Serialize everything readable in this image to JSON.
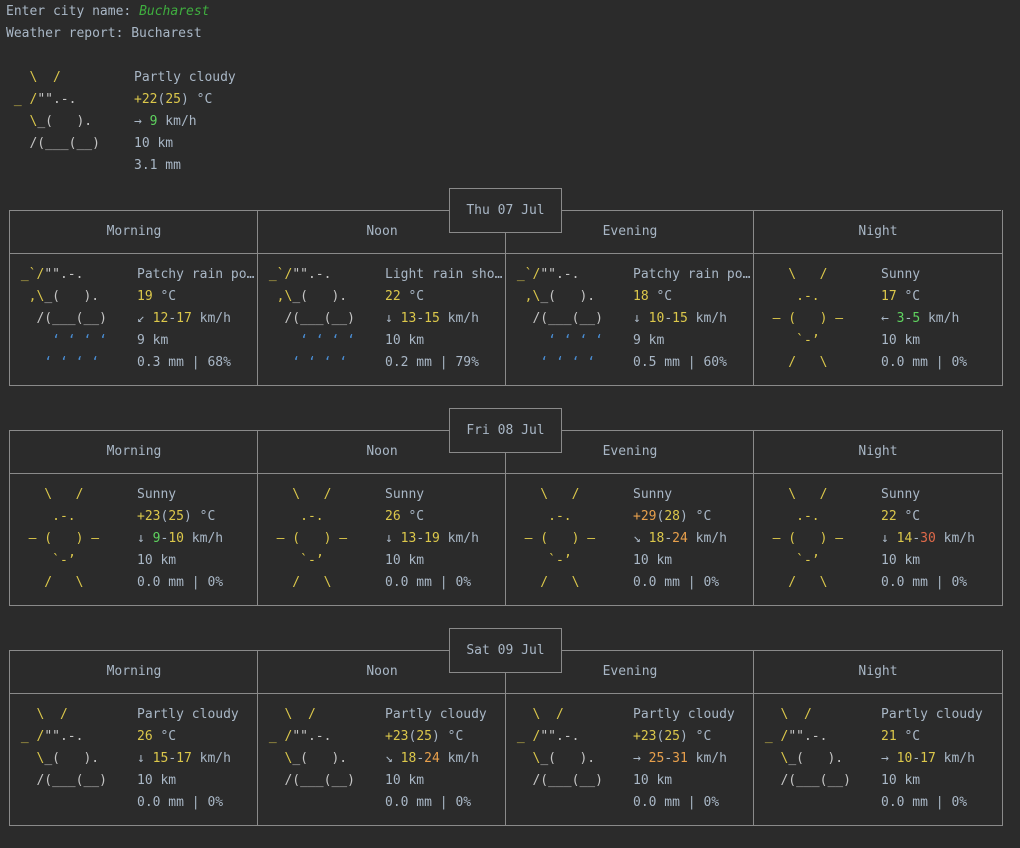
{
  "prompt": {
    "label": "Enter city name: ",
    "value": "Bucharest"
  },
  "report_title": "Weather report: Bucharest",
  "current": {
    "icon": [
      "   \\  /",
      " _ /\"\".-.",
      "   \\_(   ).",
      "   /(___(__)",
      ""
    ],
    "condition": "Partly cloudy",
    "temp_main": "+22",
    "temp_feels": "25",
    "temp_unit": " °C",
    "wind_arrow": "→",
    "wind": "9",
    "wind_unit": " km/h",
    "visibility": "10 km",
    "precip": "3.1 mm"
  },
  "days": [
    {
      "date": "Thu 07 Jul",
      "periods": [
        {
          "name": "Morning",
          "icon_type": "rain",
          "condition": "Patchy rain po…",
          "temp": "19",
          "feels": "",
          "temp_color": "yel",
          "wind_arrow": "↙",
          "wind_lo": "12",
          "wind_hi": "17",
          "wind_lo_color": "yel",
          "wind_hi_color": "yel",
          "visibility": "9 km",
          "precip": "0.3 mm | 68%"
        },
        {
          "name": "Noon",
          "icon_type": "rain",
          "condition": "Light rain sho…",
          "temp": "22",
          "feels": "",
          "temp_color": "yel",
          "wind_arrow": "↓",
          "wind_lo": "13",
          "wind_hi": "15",
          "wind_lo_color": "yel",
          "wind_hi_color": "yel",
          "visibility": "10 km",
          "precip": "0.2 mm | 79%"
        },
        {
          "name": "Evening",
          "icon_type": "rain",
          "condition": "Patchy rain po…",
          "temp": "18",
          "feels": "",
          "temp_color": "yel",
          "wind_arrow": "↓",
          "wind_lo": "10",
          "wind_hi": "15",
          "wind_lo_color": "yel",
          "wind_hi_color": "yel",
          "visibility": "9 km",
          "precip": "0.5 mm | 60%"
        },
        {
          "name": "Night",
          "icon_type": "sun",
          "condition": "Sunny",
          "temp": "17",
          "feels": "",
          "temp_color": "yel",
          "wind_arrow": "←",
          "wind_lo": "3",
          "wind_hi": "5",
          "wind_lo_color": "grn",
          "wind_hi_color": "grn",
          "visibility": "10 km",
          "precip": "0.0 mm | 0%"
        }
      ]
    },
    {
      "date": "Fri 08 Jul",
      "periods": [
        {
          "name": "Morning",
          "icon_type": "sun",
          "condition": "Sunny",
          "temp": "+23",
          "feels": "25",
          "temp_color": "yel",
          "wind_arrow": "↓",
          "wind_lo": "9",
          "wind_hi": "10",
          "wind_lo_color": "grn",
          "wind_hi_color": "yel",
          "visibility": "10 km",
          "precip": "0.0 mm | 0%"
        },
        {
          "name": "Noon",
          "icon_type": "sun",
          "condition": "Sunny",
          "temp": "26",
          "feels": "",
          "temp_color": "yel",
          "wind_arrow": "↓",
          "wind_lo": "13",
          "wind_hi": "19",
          "wind_lo_color": "yel",
          "wind_hi_color": "yel",
          "visibility": "10 km",
          "precip": "0.0 mm | 0%"
        },
        {
          "name": "Evening",
          "icon_type": "sun",
          "condition": "Sunny",
          "temp": "+29",
          "feels": "28",
          "temp_color": "org",
          "wind_arrow": "↘",
          "wind_lo": "18",
          "wind_hi": "24",
          "wind_lo_color": "yel",
          "wind_hi_color": "org",
          "visibility": "10 km",
          "precip": "0.0 mm | 0%"
        },
        {
          "name": "Night",
          "icon_type": "sun",
          "condition": "Sunny",
          "temp": "22",
          "feels": "",
          "temp_color": "yel",
          "wind_arrow": "↓",
          "wind_lo": "14",
          "wind_hi": "30",
          "wind_lo_color": "yel",
          "wind_hi_color": "red",
          "visibility": "10 km",
          "precip": "0.0 mm | 0%"
        }
      ]
    },
    {
      "date": "Sat 09 Jul",
      "periods": [
        {
          "name": "Morning",
          "icon_type": "cloud",
          "condition": "Partly cloudy",
          "temp": "26",
          "feels": "",
          "temp_color": "yel",
          "wind_arrow": "↓",
          "wind_lo": "15",
          "wind_hi": "17",
          "wind_lo_color": "yel",
          "wind_hi_color": "yel",
          "visibility": "10 km",
          "precip": "0.0 mm | 0%"
        },
        {
          "name": "Noon",
          "icon_type": "cloud",
          "condition": "Partly cloudy",
          "temp": "+23",
          "feels": "25",
          "temp_color": "yel",
          "wind_arrow": "↘",
          "wind_lo": "18",
          "wind_hi": "24",
          "wind_lo_color": "yel",
          "wind_hi_color": "org",
          "visibility": "10 km",
          "precip": "0.0 mm | 0%"
        },
        {
          "name": "Evening",
          "icon_type": "cloud",
          "condition": "Partly cloudy",
          "temp": "+23",
          "feels": "25",
          "temp_color": "yel",
          "wind_arrow": "→",
          "wind_lo": "25",
          "wind_hi": "31",
          "wind_lo_color": "org",
          "wind_hi_color": "org",
          "visibility": "10 km",
          "precip": "0.0 mm | 0%"
        },
        {
          "name": "Night",
          "icon_type": "cloud",
          "condition": "Partly cloudy",
          "temp": "21",
          "feels": "",
          "temp_color": "yel",
          "wind_arrow": "→",
          "wind_lo": "10",
          "wind_hi": "17",
          "wind_lo_color": "yel",
          "wind_hi_color": "yel",
          "visibility": "10 km",
          "precip": "0.0 mm | 0%"
        }
      ]
    }
  ],
  "units": {
    "temp": " °C",
    "wind": " km/h",
    "dash": "-"
  },
  "icons": {
    "rain": [
      " _`/\"\".-.",
      "  ,\\_(   ).",
      "   /(___(__)",
      "     ‘ ‘ ‘ ‘",
      "    ‘ ‘ ‘ ‘"
    ],
    "sun": [
      "    \\   /",
      "     .-.",
      "  ― (   ) ―",
      "     `-’",
      "    /   \\"
    ],
    "cloud": [
      "   \\  /",
      " _ /\"\".-.",
      "   \\_(   ).",
      "   /(___(__)",
      ""
    ]
  },
  "colors": {
    "sun": "#dcc84b",
    "cloud": "#c5c5c5",
    "rain_drops": "#4a8fd6"
  }
}
